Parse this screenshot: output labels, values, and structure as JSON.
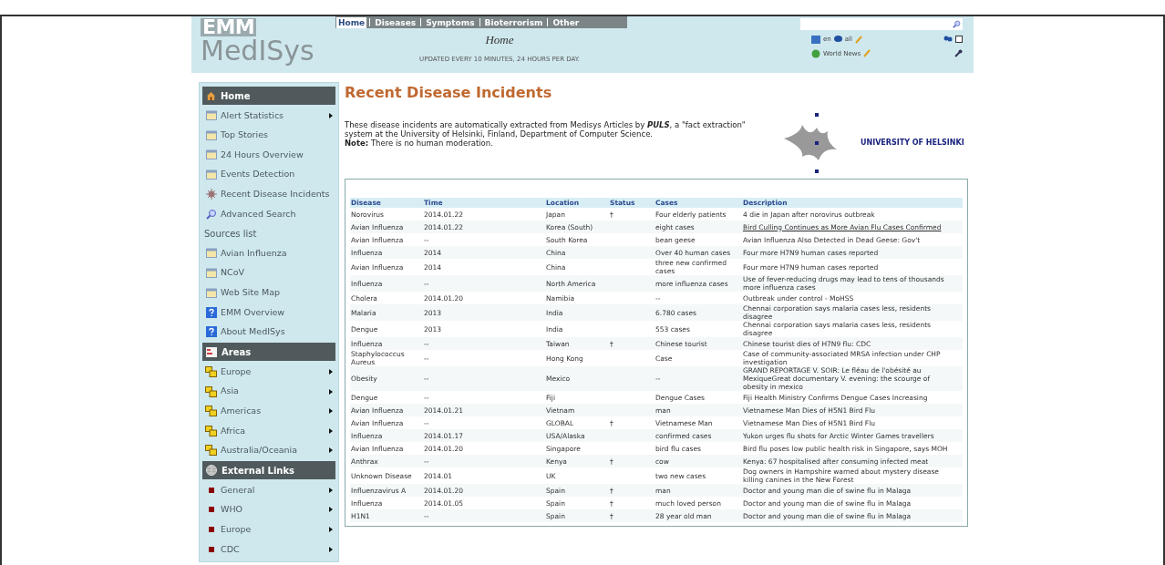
{
  "header": {
    "logo_top": "EMM",
    "logo_bottom": "MedISys",
    "nav": [
      {
        "label": "Home",
        "selected": true
      },
      {
        "label": "Diseases",
        "selected": false
      },
      {
        "label": "Symptoms",
        "selected": false
      },
      {
        "label": "Bioterrorism",
        "selected": false
      },
      {
        "label": "Other",
        "selected": false
      }
    ],
    "title": "Home",
    "subtitle": "UPDATED EVERY 10 MINUTES, 24 HOURS PER DAY.",
    "language": "en",
    "filter": "all",
    "world_news": "World News"
  },
  "sidebar": [
    {
      "kind": "header",
      "label": "Home"
    },
    {
      "kind": "item",
      "label": "Alert Statistics",
      "submenu": true
    },
    {
      "kind": "item",
      "label": "Top Stories",
      "submenu": false
    },
    {
      "kind": "item",
      "label": "24 Hours Overview",
      "submenu": false
    },
    {
      "kind": "item",
      "label": "Events Detection",
      "submenu": false
    },
    {
      "kind": "item",
      "label": "Recent Disease Incidents",
      "submenu": false
    },
    {
      "kind": "item",
      "label": "Advanced Search",
      "submenu": false
    },
    {
      "kind": "label",
      "label": "Sources list"
    },
    {
      "kind": "item",
      "label": "Avian Influenza",
      "submenu": false
    },
    {
      "kind": "item",
      "label": "NCoV",
      "submenu": false
    },
    {
      "kind": "item",
      "label": "Web Site Map",
      "submenu": false
    },
    {
      "kind": "item",
      "label": "EMM Overview",
      "submenu": false
    },
    {
      "kind": "item",
      "label": "About MedISys",
      "submenu": false
    },
    {
      "kind": "header",
      "label": "Areas"
    },
    {
      "kind": "item",
      "label": "Europe",
      "submenu": true
    },
    {
      "kind": "item",
      "label": "Asia",
      "submenu": true
    },
    {
      "kind": "item",
      "label": "Americas",
      "submenu": true
    },
    {
      "kind": "item",
      "label": "Africa",
      "submenu": true
    },
    {
      "kind": "item",
      "label": "Australia/Oceania",
      "submenu": true
    },
    {
      "kind": "header",
      "label": "External Links"
    },
    {
      "kind": "item",
      "label": "General",
      "submenu": true
    },
    {
      "kind": "item",
      "label": "WHO",
      "submenu": true
    },
    {
      "kind": "item",
      "label": "Europe",
      "submenu": true
    },
    {
      "kind": "item",
      "label": "CDC",
      "submenu": true
    }
  ],
  "main": {
    "heading": "Recent Disease Incidents",
    "intro": "These disease incidents are automatically extracted from Medisys Articles by **PULS**, a \"fact extraction\" system at the University of Helsinki, Finland, Department of Computer Science.",
    "note": "**Note:** There is no human moderation.",
    "university": "UNIVERSITY OF HELSINKI"
  },
  "table": {
    "columns": [
      "Disease",
      "Time",
      "Location",
      "Status",
      "Cases",
      "Description"
    ],
    "rows": [
      {
        "disease": "Norovirus",
        "time": "2014.01.22",
        "location": "Japan",
        "status": "†",
        "cases": "Four elderly patients",
        "description": "4 die in Japan after norovirus outbreak",
        "link": false
      },
      {
        "disease": "Avian Influenza",
        "time": "2014.01.22",
        "location": "Korea (South)",
        "status": "",
        "cases": "eight cases",
        "description": "Bird Culling Continues as More Avian Flu Cases Confirmed",
        "link": true
      },
      {
        "disease": "Avian Influenza",
        "time": "--",
        "location": "South Korea",
        "status": "",
        "cases": "bean geese",
        "description": "Avian Influenza Also Detected in Dead Geese: Gov't",
        "link": false
      },
      {
        "disease": "Influenza",
        "time": "2014",
        "location": "China",
        "status": "",
        "cases": "Over 40 human cases",
        "description": "Four more H7N9 human cases reported",
        "link": false
      },
      {
        "disease": "Avian Influenza",
        "time": "2014",
        "location": "China",
        "status": "",
        "cases": "three new confirmed cases",
        "description": "Four more H7N9 human cases reported",
        "link": false
      },
      {
        "disease": "Influenza",
        "time": "--",
        "location": "North America",
        "status": "",
        "cases": "more influenza cases",
        "description": "Use of fever-reducing drugs may lead to tens of thousands more influenza cases",
        "link": false
      },
      {
        "disease": "Cholera",
        "time": "2014.01.20",
        "location": "Namibia",
        "status": "",
        "cases": "--",
        "description": "Outbreak under control - MoHSS",
        "link": false
      },
      {
        "disease": "Malaria",
        "time": "2013",
        "location": "India",
        "status": "",
        "cases": "6.780 cases",
        "description": "Chennai corporation says malaria cases less, residents disagree",
        "link": false
      },
      {
        "disease": "Dengue",
        "time": "2013",
        "location": "India",
        "status": "",
        "cases": "553 cases",
        "description": "Chennai corporation says malaria cases less, residents disagree",
        "link": false
      },
      {
        "disease": "Influenza",
        "time": "--",
        "location": "Taiwan",
        "status": "†",
        "cases": "Chinese tourist",
        "description": "Chinese tourist dies of H7N9 flu: CDC",
        "link": false
      },
      {
        "disease": "Staphylococcus Aureus",
        "time": "--",
        "location": "Hong Kong",
        "status": "",
        "cases": "Case",
        "description": "Case of community-associated MRSA infection under CHP investigation",
        "link": false
      },
      {
        "disease": "Obesity",
        "time": "--",
        "location": "Mexico",
        "status": "",
        "cases": "--",
        "description": "GRAND REPORTAGE V. SOIR: Le fléau de l'obésité au MexiqueGreat documentary V. evening: the scourge of obesity in mexico",
        "link": false
      },
      {
        "disease": "Dengue",
        "time": "--",
        "location": "Fiji",
        "status": "",
        "cases": "Dengue Cases",
        "description": "Fiji Health Ministry Confirms Dengue Cases Increasing",
        "link": false
      },
      {
        "disease": "Avian Influenza",
        "time": "2014.01.21",
        "location": "Vietnam",
        "status": "",
        "cases": "man",
        "description": "Vietnamese Man Dies of H5N1 Bird Flu",
        "link": false
      },
      {
        "disease": "Avian Influenza",
        "time": "--",
        "location": "GLOBAL",
        "status": "†",
        "cases": "Vietnamese Man",
        "description": "Vietnamese Man Dies of H5N1 Bird Flu",
        "link": false
      },
      {
        "disease": "Influenza",
        "time": "2014.01.17",
        "location": "USA/Alaska",
        "status": "",
        "cases": "confirmed cases",
        "description": "Yukon urges flu shots for Arctic Winter Games travellers",
        "link": false
      },
      {
        "disease": "Avian Influenza",
        "time": "2014.01.20",
        "location": "Singapore",
        "status": "",
        "cases": "bird flu cases",
        "description": "Bird flu poses low public health risk in Singapore, says MOH",
        "link": false
      },
      {
        "disease": "Anthrax",
        "time": "--",
        "location": "Kenya",
        "status": "†",
        "cases": "cow",
        "description": "Kenya: 67 hospitalised after consuming infected meat",
        "link": false
      },
      {
        "disease": "Unknown Disease",
        "time": "2014.01",
        "location": "UK",
        "status": "",
        "cases": "two new cases",
        "description": "Dog owners in Hampshire warned about mystery disease killing canines in the New Forest",
        "link": false
      },
      {
        "disease": "Influenzavirus A",
        "time": "2014.01.20",
        "location": "Spain",
        "status": "†",
        "cases": "man",
        "description": "Doctor and young man die of swine flu in Malaga",
        "link": false
      },
      {
        "disease": "Influenza",
        "time": "2014.01.05",
        "location": "Spain",
        "status": "†",
        "cases": "much loved person",
        "description": "Doctor and young man die of swine flu in Malaga",
        "link": false
      },
      {
        "disease": "H1N1",
        "time": "--",
        "location": "Spain",
        "status": "†",
        "cases": "28 year old man",
        "description": "Doctor and young man die of swine flu in Malaga",
        "link": false
      }
    ]
  }
}
